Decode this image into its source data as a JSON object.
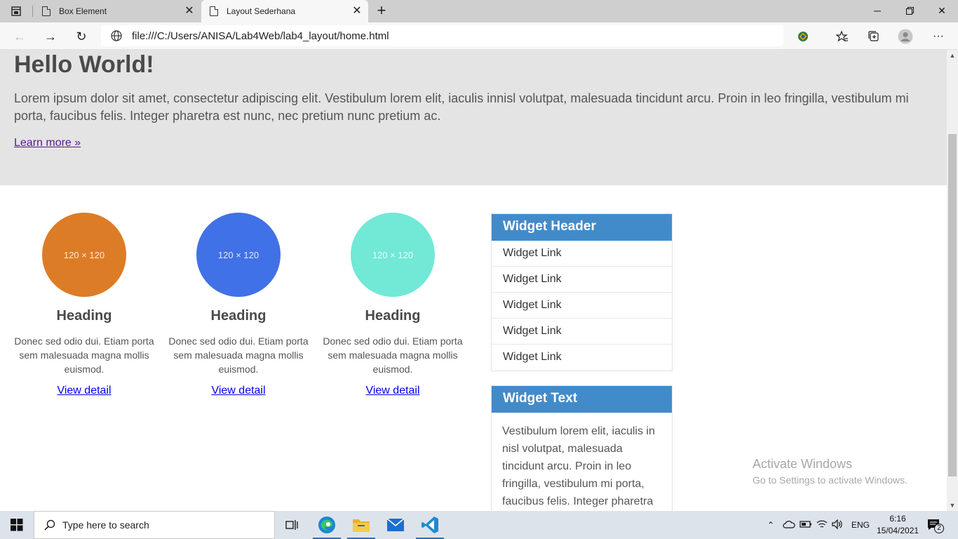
{
  "browser": {
    "tabs": [
      {
        "title": "Box Element",
        "active": false
      },
      {
        "title": "Layout Sederhana",
        "active": true
      }
    ],
    "address": "file:///C:/Users/ANISA/Lab4Web/lab4_layout/home.html"
  },
  "hero": {
    "title": "Hello World!",
    "text": "Lorem ipsum dolor sit amet, consectetur adipiscing elit. Vestibulum lorem elit, iaculis innisl volutpat, malesuada tincidunt arcu. Proin in leo fringilla, vestibulum mi porta, faucibus felis. Integer pharetra est nunc, nec pretium nunc pretium ac.",
    "link": "Learn more »"
  },
  "columns": [
    {
      "image_label": "120 × 120",
      "color": "#dd7c26",
      "heading": "Heading",
      "text": "Donec sed odio dui. Etiam porta sem malesuada magna mollis euismod.",
      "link": "View detail"
    },
    {
      "image_label": "120 × 120",
      "color": "#4171e6",
      "heading": "Heading",
      "text": "Donec sed odio dui. Etiam porta sem malesuada magna mollis euismod.",
      "link": "View detail"
    },
    {
      "image_label": "120 × 120",
      "color": "#72e8d7",
      "heading": "Heading",
      "text": "Donec sed odio dui. Etiam porta sem malesuada magna mollis euismod.",
      "link": "View detail"
    }
  ],
  "widget_links": {
    "header": "Widget Header",
    "links": [
      "Widget Link",
      "Widget Link",
      "Widget Link",
      "Widget Link",
      "Widget Link"
    ]
  },
  "widget_text": {
    "header": "Widget Text",
    "text": "Vestibulum lorem elit, iaculis in nisl volutpat, malesuada tincidunt arcu. Proin in leo fringilla, vestibulum mi porta, faucibus felis. Integer pharetra"
  },
  "watermark": {
    "line1": "Activate Windows",
    "line2": "Go to Settings to activate Windows."
  },
  "taskbar": {
    "search_placeholder": "Type here to search",
    "language": "ENG",
    "time": "6:16",
    "date": "15/04/2021",
    "notification_count": "2"
  },
  "colors": {
    "accent": "#428bca",
    "hero_bg": "#e4e4e4"
  }
}
